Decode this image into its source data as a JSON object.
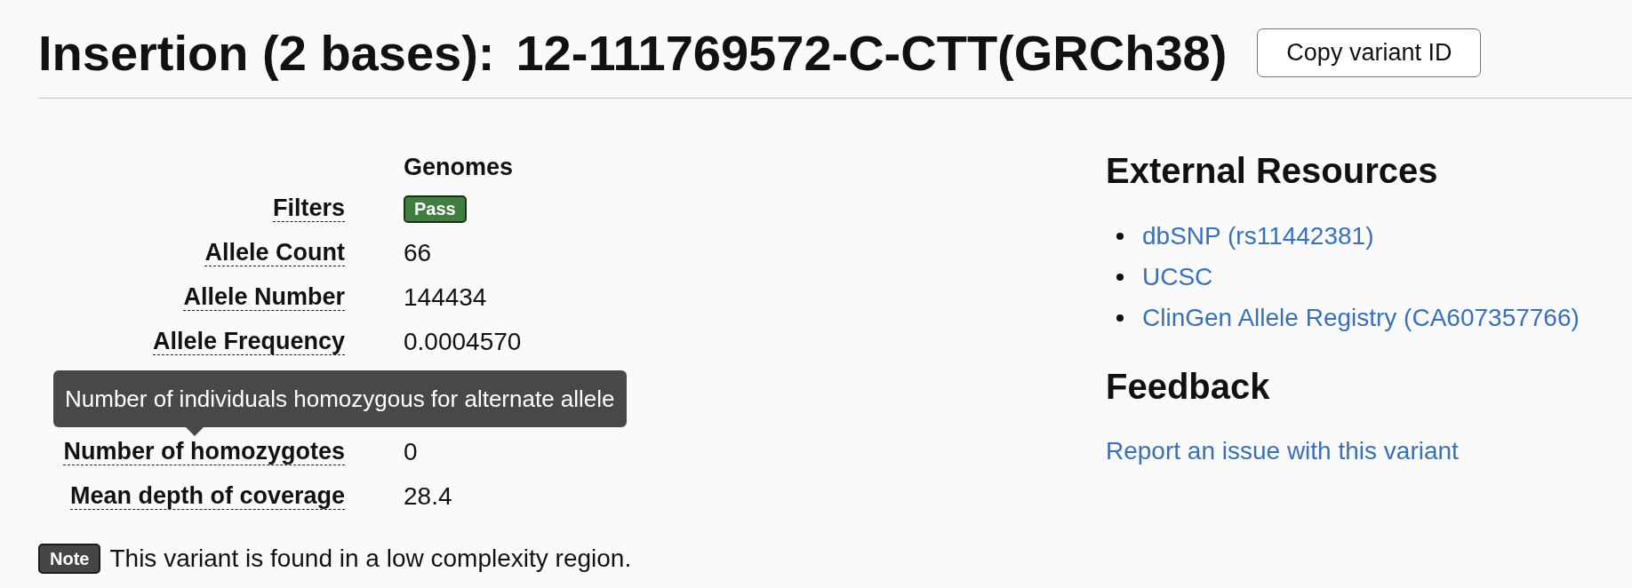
{
  "header": {
    "title": "Insertion (2 bases):",
    "variant_id": "12-111769572-C-CTT(GRCh38)",
    "copy_button": "Copy variant ID"
  },
  "frequency_table": {
    "columns": [
      "Genomes"
    ],
    "rows": [
      {
        "label": "Filters",
        "kind": "badge",
        "value": "Pass"
      },
      {
        "label": "Allele Count",
        "kind": "text",
        "value": "66"
      },
      {
        "label": "Allele Number",
        "kind": "text",
        "value": "144434"
      },
      {
        "label": "Allele Frequency",
        "kind": "text",
        "value": "0.0004570"
      },
      {
        "label": "Number of homozygotes",
        "kind": "text",
        "value": "0",
        "tooltip": "Number of individuals homozygous for alternate allele"
      },
      {
        "label": "Mean depth of coverage",
        "kind": "text",
        "value": "28.4"
      }
    ]
  },
  "note": {
    "badge": "Note",
    "text": "This variant is found in a low complexity region."
  },
  "external_resources": {
    "title": "External Resources",
    "links": [
      "dbSNP (rs11442381)",
      "UCSC",
      "ClinGen Allele Registry (CA607357766)"
    ]
  },
  "feedback": {
    "title": "Feedback",
    "link": "Report an issue with this variant"
  }
}
